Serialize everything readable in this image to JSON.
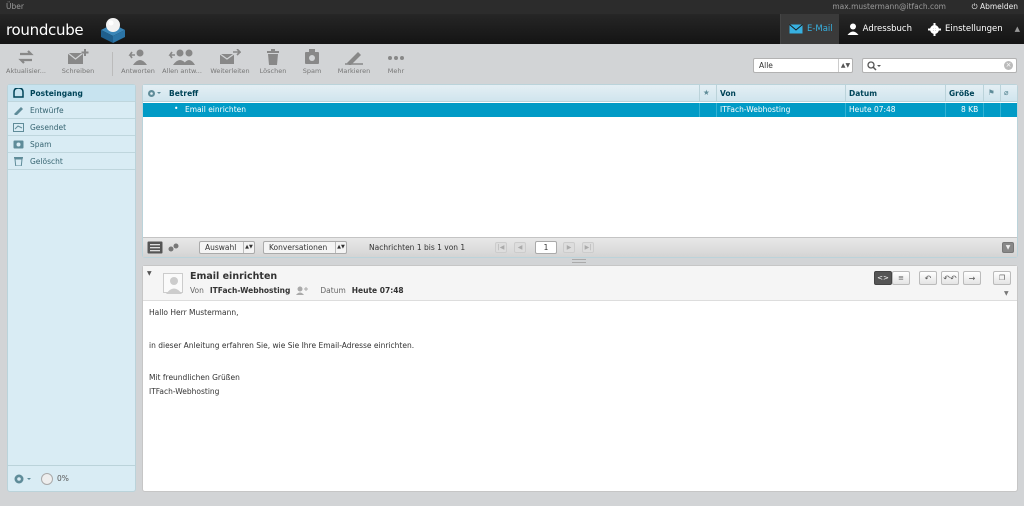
{
  "topbar": {
    "about": "Über",
    "user": "max.mustermann@itfach.com",
    "logout": "Abmelden"
  },
  "header": {
    "logo": "roundcube",
    "nav": [
      {
        "label": "E-Mail"
      },
      {
        "label": "Adressbuch"
      },
      {
        "label": "Einstellungen"
      }
    ]
  },
  "toolbar": {
    "buttons": [
      {
        "label": "Aktualisier..."
      },
      {
        "label": "Schreiben"
      },
      {
        "label": "Antworten"
      },
      {
        "label": "Allen antw..."
      },
      {
        "label": "Weiterleiten"
      },
      {
        "label": "Löschen"
      },
      {
        "label": "Spam"
      },
      {
        "label": "Markieren"
      },
      {
        "label": "Mehr"
      }
    ]
  },
  "filter": {
    "value": "Alle"
  },
  "search": {
    "placeholder": ""
  },
  "folders": [
    {
      "label": "Posteingang"
    },
    {
      "label": "Entwürfe"
    },
    {
      "label": "Gesendet"
    },
    {
      "label": "Spam"
    },
    {
      "label": "Gelöscht"
    }
  ],
  "quota": {
    "value": "0%"
  },
  "list": {
    "columns": {
      "subject": "Betreff",
      "from": "Von",
      "date": "Datum",
      "size": "Größe"
    },
    "rows": [
      {
        "subject": "Email einrichten",
        "from": "ITFach-Webhosting",
        "date": "Heute 07:48",
        "size": "8 KB"
      }
    ],
    "footer": {
      "select": "Auswahl",
      "threads": "Konversationen",
      "count": "Nachrichten 1 bis 1 von 1",
      "page": "1"
    }
  },
  "preview": {
    "subject": "Email einrichten",
    "from_label": "Von",
    "from": "ITFach-Webhosting",
    "date_label": "Datum",
    "date": "Heute 07:48",
    "body": [
      "Hallo Herr Mustermann,",
      "in dieser Anleitung erfahren Sie, wie Sie Ihre Email-Adresse einrichten.",
      "Mit freundlichen Grüßen",
      "ITFach-Webhosting"
    ]
  },
  "colors": {
    "accent": "#37b0e0",
    "selected_row": "#019bc6"
  }
}
